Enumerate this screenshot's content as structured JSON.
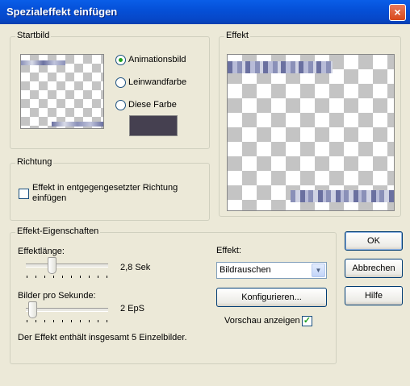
{
  "window": {
    "title": "Spezialeffekt einfügen",
    "close_glyph": "×"
  },
  "startbild": {
    "label": "Startbild",
    "options": [
      {
        "label": "Animationsbild",
        "checked": true
      },
      {
        "label": "Leinwandfarbe",
        "checked": false
      },
      {
        "label": "Diese Farbe",
        "checked": false
      }
    ],
    "swatch_color": "#454050"
  },
  "effekt_preview": {
    "label": "Effekt"
  },
  "richtung": {
    "label": "Richtung",
    "checkbox_line1": "Effekt in entgegengesetzter Richtung",
    "checkbox_line2": "einfügen",
    "checked": false
  },
  "eigenschaften": {
    "label": "Effekt-Eigenschaften",
    "laenge_label": "Effektlänge:",
    "laenge_value": "2,8 Sek",
    "fps_label": "Bilder pro Sekunde:",
    "fps_value": "2 EpS",
    "summary": "Der Effekt enthält insgesamt 5 Einzelbilder.",
    "effekt_label": "Effekt:",
    "effekt_selected": "Bildrauschen",
    "configure_label": "Konfigurieren...",
    "preview_label": "Vorschau anzeigen",
    "preview_checked": true
  },
  "buttons": {
    "ok": "OK",
    "cancel": "Abbrechen",
    "help": "Hilfe"
  },
  "icons": {
    "dropdown": "chevron-down-icon",
    "check": "check-icon"
  }
}
